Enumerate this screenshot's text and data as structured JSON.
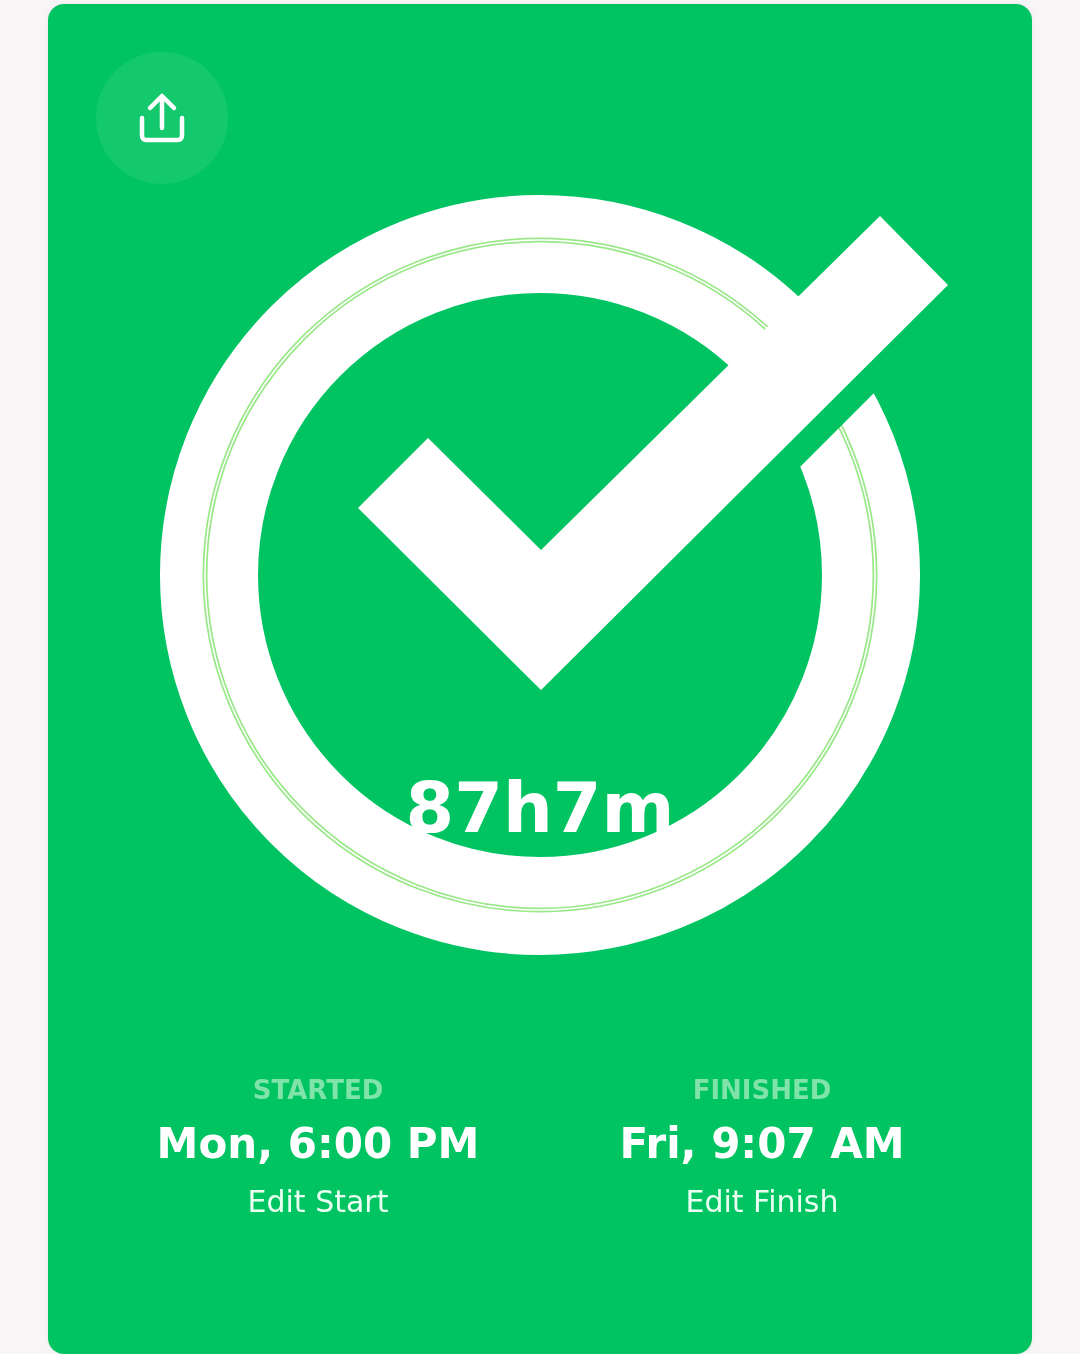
{
  "completed": true,
  "duration": "87h7m",
  "stats": [
    {
      "label": "STARTED",
      "value": "Mon, 6:00 PM",
      "action": "Edit Start"
    },
    {
      "label": "FINISHED",
      "value": "Fri, 9:07 AM",
      "action": "Edit Finish"
    }
  ]
}
